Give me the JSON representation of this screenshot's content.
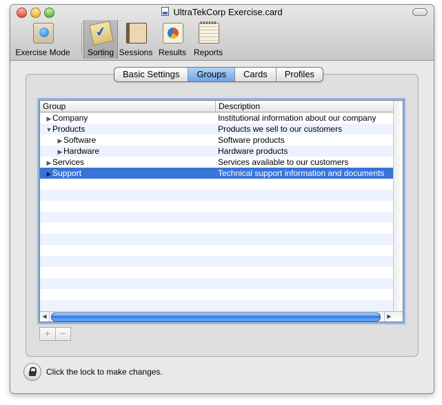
{
  "window": {
    "title": "UltraTekCorp Exercise.card"
  },
  "toolbar": {
    "items": [
      {
        "label": "Exercise Mode",
        "icon": "exercise-mode-icon"
      },
      {
        "label": "Sorting",
        "icon": "sorting-icon",
        "selected": true
      },
      {
        "label": "Sessions",
        "icon": "sessions-icon"
      },
      {
        "label": "Results",
        "icon": "results-icon"
      },
      {
        "label": "Reports",
        "icon": "reports-icon"
      }
    ]
  },
  "tabs": [
    {
      "label": "Basic Settings"
    },
    {
      "label": "Groups",
      "active": true
    },
    {
      "label": "Cards"
    },
    {
      "label": "Profiles"
    }
  ],
  "table": {
    "columns": {
      "group": "Group",
      "description": "Description"
    },
    "rows": [
      {
        "disclosure": "▶",
        "group": "Company",
        "description": "Institutional information about our company",
        "indent": 0
      },
      {
        "disclosure": "▼",
        "group": "Products",
        "description": "Products we sell to our customers",
        "indent": 0
      },
      {
        "disclosure": "▶",
        "group": "Software",
        "description": "Software products",
        "indent": 1
      },
      {
        "disclosure": "▶",
        "group": "Hardware",
        "description": "Hardware products",
        "indent": 1
      },
      {
        "disclosure": "▶",
        "group": "Services",
        "description": "Services available to our customers",
        "indent": 0
      },
      {
        "disclosure": "▶",
        "group": "Support",
        "description": "Technical support information and documents",
        "indent": 0,
        "selected": true
      }
    ]
  },
  "scroll": {
    "left_arrow": "◀",
    "right_arrow": "▶"
  },
  "controls": {
    "add": "+",
    "remove": "−"
  },
  "lock": {
    "text": "Click the lock to make changes."
  },
  "colors": {
    "selection": "#3875d7",
    "tab_active": "#6ea4e8",
    "stripe": "#edf3fe"
  }
}
